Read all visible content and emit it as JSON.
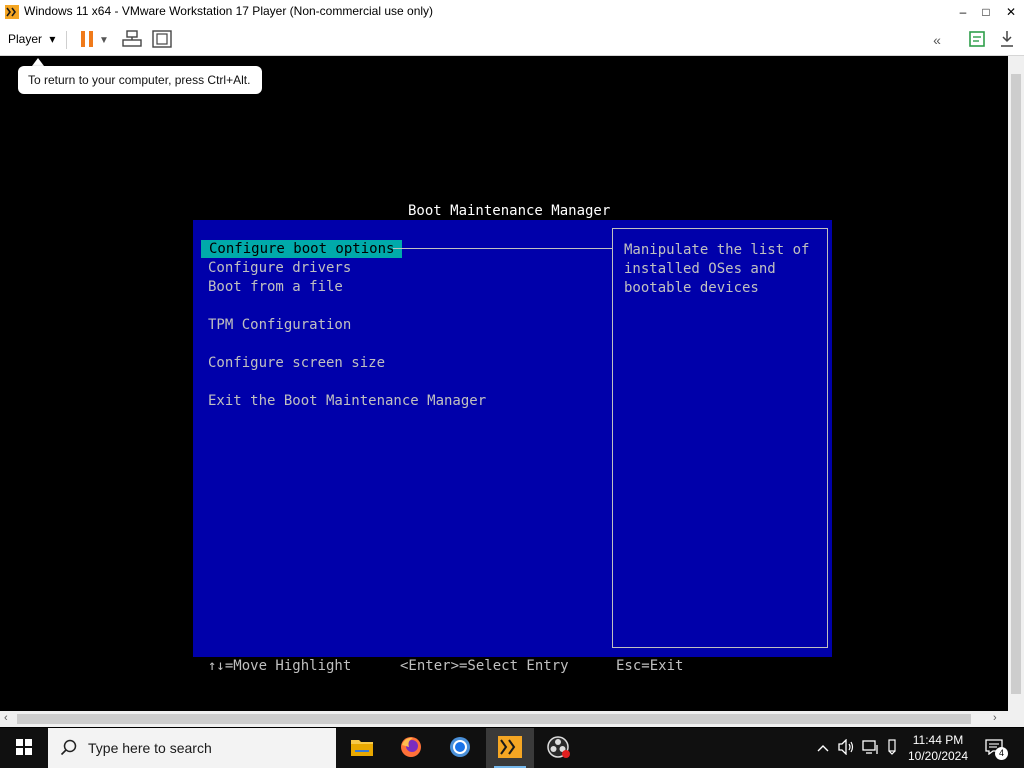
{
  "window": {
    "title": "Windows 11 x64 - VMware Workstation 17 Player (Non-commercial use only)",
    "minimize": "–",
    "maximize": "□",
    "close": "✕"
  },
  "toolbar": {
    "player_label": "Player",
    "tooltip": "To return to your computer, press Ctrl+Alt."
  },
  "bios": {
    "title": "Boot Maintenance Manager",
    "menu": [
      {
        "label": "Configure boot options",
        "selected": true
      },
      {
        "label": "Configure drivers",
        "selected": false
      },
      {
        "label": "Boot from a file",
        "selected": false
      },
      {
        "label": "TPM Configuration",
        "selected": false
      },
      {
        "label": "Configure screen size",
        "selected": false
      },
      {
        "label": "Exit the Boot Maintenance Manager",
        "selected": false
      }
    ],
    "help": [
      "Manipulate the list of",
      "installed OSes and",
      "bootable devices"
    ],
    "footer": {
      "move": "↑↓=Move Highlight",
      "select": "<Enter>=Select Entry",
      "exit": "Esc=Exit"
    },
    "colors": {
      "panel": "#0000aa",
      "highlight": "#00aaaa",
      "text": "#c0c0c0"
    }
  },
  "taskbar": {
    "search_placeholder": "Type here to search",
    "time": "11:44 PM",
    "date": "10/20/2024",
    "notification_count": "4",
    "apps": [
      {
        "name": "file-explorer"
      },
      {
        "name": "firefox"
      },
      {
        "name": "chrome"
      },
      {
        "name": "vmware-player"
      },
      {
        "name": "obs-studio"
      }
    ]
  }
}
